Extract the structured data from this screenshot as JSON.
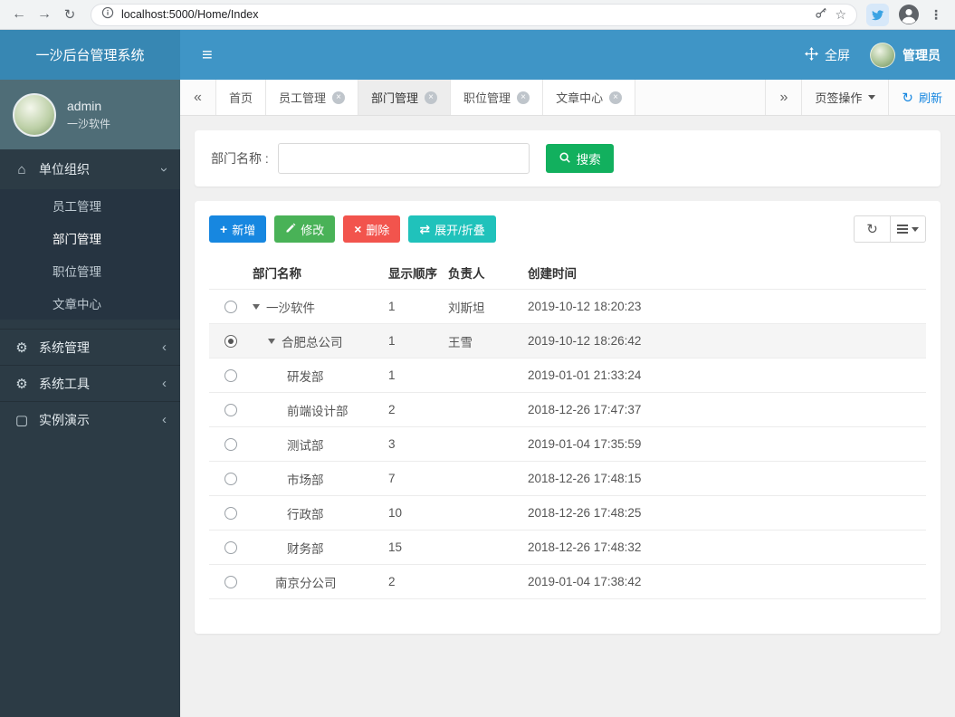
{
  "browser": {
    "url": "localhost:5000/Home/Index"
  },
  "icons": {
    "back": "←",
    "forward": "→",
    "reload": "↻",
    "star": "☆",
    "dots": "⋮",
    "menu": "≡",
    "home": "⌂",
    "gear": "⚙",
    "cogs": "⚙",
    "demo": "▢",
    "chevron": "›",
    "chevron_left": "‹",
    "tabs_left": "«",
    "tabs_right": "»",
    "refresh": "↻",
    "swap": "⇄",
    "plus": "+",
    "x": "×",
    "close": "×"
  },
  "header": {
    "brand": "一沙后台管理系统",
    "fullscreen": "全屏",
    "user": "管理员"
  },
  "sidebar": {
    "user": {
      "name": "admin",
      "org": "一沙软件"
    },
    "menu": [
      {
        "label": "单位组织",
        "children": [
          "员工管理",
          "部门管理",
          "职位管理",
          "文章中心"
        ]
      },
      {
        "label": "系统管理"
      },
      {
        "label": "系统工具"
      },
      {
        "label": "实例演示"
      }
    ]
  },
  "tabs": {
    "items": [
      {
        "label": "首页"
      },
      {
        "label": "员工管理"
      },
      {
        "label": "部门管理"
      },
      {
        "label": "职位管理"
      },
      {
        "label": "文章中心"
      }
    ],
    "ops": "页签操作",
    "refresh": "刷新"
  },
  "search": {
    "label": "部门名称 :",
    "value": "",
    "button": "搜索"
  },
  "toolbar": {
    "add": "新增",
    "edit": "修改",
    "del": "删除",
    "toggle": "展开/折叠"
  },
  "table": {
    "headers": [
      "部门名称",
      "显示顺序",
      "负责人",
      "创建时间"
    ],
    "rows": [
      {
        "name": "一沙软件",
        "order": "1",
        "owner": "刘斯坦",
        "created": "2019-10-12 18:20:23"
      },
      {
        "name": "合肥总公司",
        "order": "1",
        "owner": "王雪",
        "created": "2019-10-12 18:26:42"
      },
      {
        "name": "研发部",
        "order": "1",
        "owner": "",
        "created": "2019-01-01 21:33:24"
      },
      {
        "name": "前端设计部",
        "order": "2",
        "owner": "",
        "created": "2018-12-26 17:47:37"
      },
      {
        "name": "测试部",
        "order": "3",
        "owner": "",
        "created": "2019-01-04 17:35:59"
      },
      {
        "name": "市场部",
        "order": "7",
        "owner": "",
        "created": "2018-12-26 17:48:15"
      },
      {
        "name": "行政部",
        "order": "10",
        "owner": "",
        "created": "2018-12-26 17:48:25"
      },
      {
        "name": "财务部",
        "order": "15",
        "owner": "",
        "created": "2018-12-26 17:48:32"
      },
      {
        "name": "南京分公司",
        "order": "2",
        "owner": "",
        "created": "2019-01-04 17:38:42"
      }
    ]
  },
  "colors": {
    "header": "#3f95c6",
    "logo": "#3787b3",
    "sidebar": "#2c3b45",
    "accent_blue": "#1787e0",
    "green": "#49b257",
    "red": "#f2544d",
    "teal": "#20c2bb",
    "search_green": "#12b05e"
  }
}
